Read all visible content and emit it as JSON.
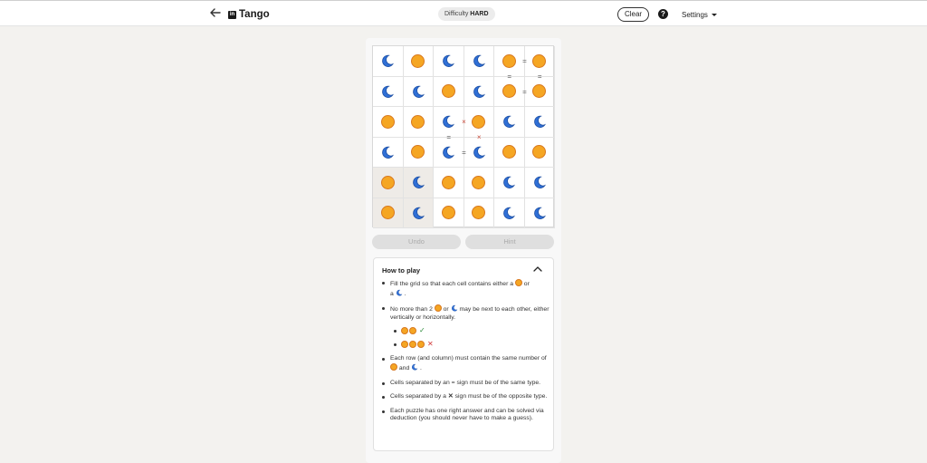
{
  "header": {
    "back_icon": "arrow-left-icon",
    "brand_logo_text": "in",
    "title": "Tango",
    "difficulty_label": "Difficulty",
    "difficulty_value": "HARD",
    "clear_label": "Clear",
    "help_glyph": "?",
    "settings_label": "Settings"
  },
  "board": {
    "rows": [
      [
        "moon",
        "sun",
        "moon",
        "moon",
        "sun",
        "sun"
      ],
      [
        "moon",
        "moon",
        "sun",
        "moon",
        "sun",
        "sun"
      ],
      [
        "sun",
        "sun",
        "moon",
        "sun",
        "moon",
        "moon"
      ],
      [
        "moon",
        "sun",
        "moon",
        "moon",
        "sun",
        "sun"
      ],
      [
        "sun",
        "moon",
        "sun",
        "sun",
        "moon",
        "moon"
      ],
      [
        "sun",
        "moon",
        "sun",
        "sun",
        "moon",
        "moon"
      ]
    ],
    "locked_cells": [
      [
        4,
        0
      ],
      [
        4,
        1
      ],
      [
        5,
        0
      ],
      [
        5,
        1
      ]
    ],
    "constraints": [
      {
        "type": "=",
        "orientation": "h",
        "row": 0,
        "col": 4
      },
      {
        "type": "=",
        "orientation": "v",
        "row": 0,
        "col": 4
      },
      {
        "type": "=",
        "orientation": "v",
        "row": 0,
        "col": 5
      },
      {
        "type": "=",
        "orientation": "h",
        "row": 1,
        "col": 4
      },
      {
        "type": "×",
        "orientation": "h",
        "row": 2,
        "col": 2
      },
      {
        "type": "=",
        "orientation": "v",
        "row": 2,
        "col": 2
      },
      {
        "type": "×",
        "orientation": "v",
        "row": 2,
        "col": 3
      },
      {
        "type": "=",
        "orientation": "h",
        "row": 3,
        "col": 2
      }
    ],
    "colors": {
      "sun": "#f5a623",
      "sun_border": "#d8781f",
      "moon": "#2f6fd6",
      "cross": "#c84a3a"
    }
  },
  "actions": {
    "undo_label": "Undo",
    "hint_label": "Hint"
  },
  "how_to_play": {
    "title": "How to play",
    "collapse_icon": "chevron-up-icon",
    "rule1_a": "Fill the grid so that each cell contains either a",
    "rule1_b": "or",
    "rule1_c": "a",
    "rule1_d": ".",
    "rule2_a": "No more than 2",
    "rule2_b": "or",
    "rule2_c": "may be next to each other, either vertically or horizontally.",
    "example_ok": "✓",
    "example_bad": "✕",
    "rule3_a": "Each row (and column) must contain the same number of",
    "rule3_b": "and",
    "rule3_c": ".",
    "rule4": "Cells separated by an = sign must be of the same type.",
    "rule5_a": "Cells separated by a",
    "rule5_glyph": "✕",
    "rule5_b": "sign must be of the opposite type.",
    "rule6": "Each puzzle has one right answer and can be solved via deduction (you should never have to make a guess)."
  }
}
